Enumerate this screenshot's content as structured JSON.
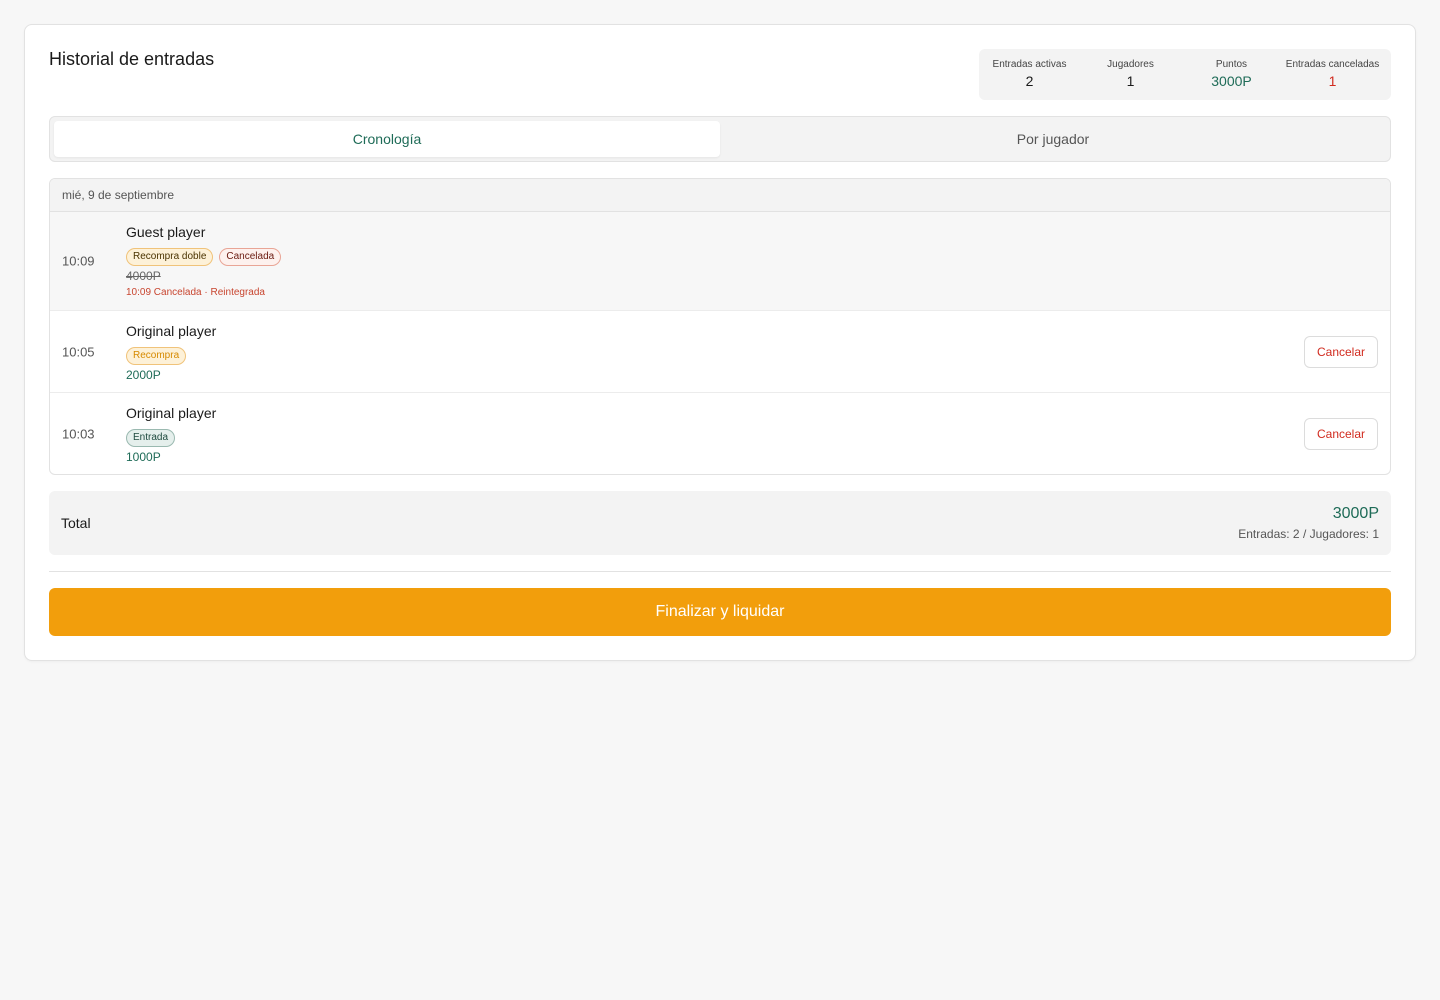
{
  "header": {
    "title": "Historial de entradas"
  },
  "stats": [
    {
      "label": "Entradas activas",
      "value": "2",
      "tone": "default"
    },
    {
      "label": "Jugadores",
      "value": "1",
      "tone": "default"
    },
    {
      "label": "Puntos",
      "value": "3000P",
      "tone": "green"
    },
    {
      "label": "Entradas canceladas",
      "value": "1",
      "tone": "red"
    }
  ],
  "tabs": [
    {
      "label": "Cronología",
      "active": true
    },
    {
      "label": "Por jugador",
      "active": false
    }
  ],
  "timeline": {
    "day_label": "mié, 9 de septiembre",
    "entries": [
      {
        "time": "10:09",
        "player": "Guest player",
        "badges": [
          "Recompra doble",
          "Cancelada"
        ],
        "amount": "4000P",
        "cancel_note": "10:09 Cancelada · Reintegrada"
      },
      {
        "time": "10:05",
        "player": "Original player",
        "badges": [
          "Recompra"
        ],
        "amount": "2000P",
        "action": "Cancelar"
      },
      {
        "time": "10:03",
        "player": "Original player",
        "badges": [
          "Entrada"
        ],
        "amount": "1000P",
        "action": "Cancelar"
      }
    ]
  },
  "total": {
    "label": "Total",
    "amount": "3000P",
    "summary": "Entradas: 2 / Jugadores: 1"
  },
  "actions": {
    "finalize_label": "Finalizar y liquidar"
  },
  "colors": {
    "accent_green": "#1e6b57",
    "danger_red": "#d12b1f",
    "primary_orange": "#f29e0c"
  }
}
